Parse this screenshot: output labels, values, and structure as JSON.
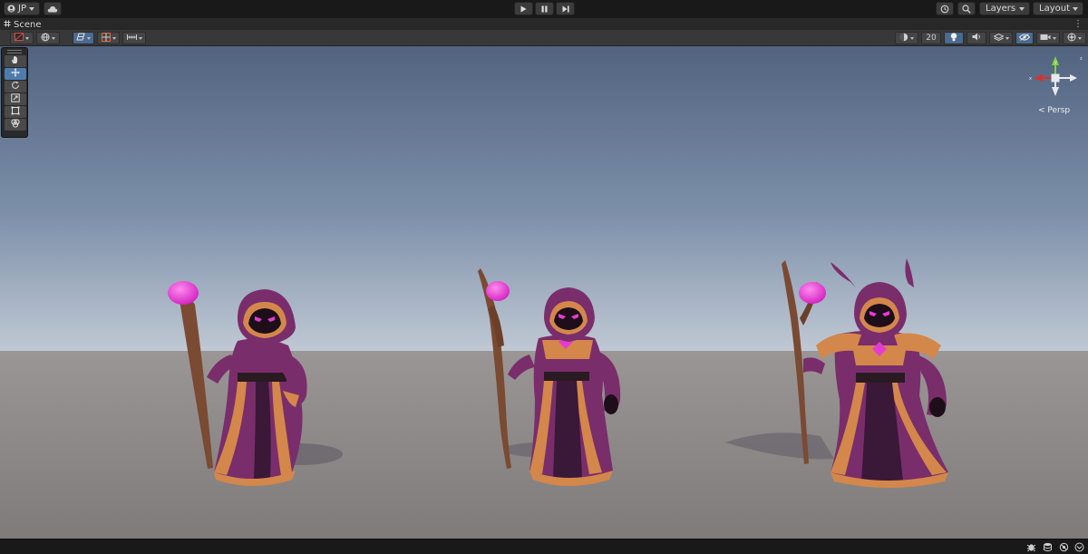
{
  "topbar": {
    "account_label": "JP",
    "layers_label": "Layers",
    "layout_label": "Layout"
  },
  "tab": {
    "scene_label": "Scene",
    "menu_glyph": "⋮"
  },
  "scenebar": {
    "grid_size_label": "20"
  },
  "gizmo": {
    "projection_label": "< Persp",
    "axis_colors": {
      "x": "#d5322f",
      "y": "#7fd43a",
      "z": "#4a7fdc"
    }
  },
  "icons": [
    "account-icon",
    "cloud-icon",
    "play-icon",
    "pause-icon",
    "step-icon",
    "history-icon",
    "search-icon",
    "hand-tool-icon",
    "move-tool-icon",
    "rotate-tool-icon",
    "scale-tool-icon",
    "rect-tool-icon",
    "transform-tool-icon",
    "lighting-icon",
    "audio-icon",
    "effects-icon",
    "visibility-icon",
    "camera-icon",
    "gizmos-icon"
  ],
  "colors": {
    "sky_top": "#51637f",
    "sky_horizon": "#b8c4d2",
    "ground": "#8a8686",
    "robe": "#7a2d6b",
    "trim": "#d4874a",
    "orb": "#e53cd0"
  }
}
